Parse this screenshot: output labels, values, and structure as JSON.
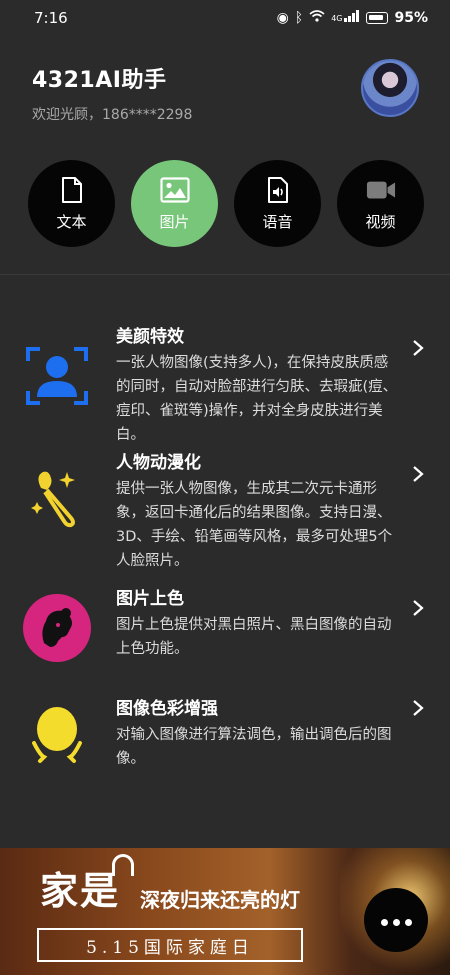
{
  "status_bar": {
    "time": "7:16",
    "icons": [
      "eye-icon",
      "bluetooth-icon",
      "wifi-icon",
      "signal-icon",
      "battery-icon"
    ],
    "network_label": "4G",
    "battery": "95%"
  },
  "header": {
    "title": "4321AI助手",
    "welcome": "欢迎光顾，186****2298"
  },
  "modes": [
    {
      "label": "文本",
      "icon": "document-icon",
      "active": false
    },
    {
      "label": "图片",
      "icon": "image-icon",
      "active": true
    },
    {
      "label": "语音",
      "icon": "audio-file-icon",
      "active": false
    },
    {
      "label": "视频",
      "icon": "video-camera-icon",
      "active": false
    }
  ],
  "features": [
    {
      "title": "美颜特效",
      "description": "一张人物图像(支持多人)，在保持皮肤质感的同时，自动对脸部进行匀肤、去瑕疵(痘、痘印、雀斑等)操作，并对全身皮肤进行美白。",
      "icon": "face-scan-icon",
      "color": "#1e6ff0"
    },
    {
      "title": "人物动漫化",
      "description": "提供一张人物图像，生成其二次元卡通形象，返回卡通化后的结果图像。支持日漫、3D、手绘、铅笔画等风格，最多可处理5个人脸照片。",
      "icon": "magic-brush-icon",
      "color": "#f2d22e"
    },
    {
      "title": "图片上色",
      "description": "图片上色提供对黑白照片、黑白图像的自动上色功能。",
      "icon": "portrait-silhouette-icon",
      "color": "#d6257e"
    },
    {
      "title": "图像色彩增强",
      "description": "对输入图像进行算法调色，输出调色后的图像。",
      "icon": "mirror-icon",
      "color": "#f4dc2c"
    }
  ],
  "banner": {
    "main_text": "家是",
    "sub_text": "深夜归来还亮的灯",
    "box_text": "5.15国际家庭日"
  },
  "fab": {
    "icon": "more-dots-icon"
  },
  "colors": {
    "background": "#2b2b2b",
    "active_mode": "#78c67a",
    "mode_circle": "#050505"
  }
}
